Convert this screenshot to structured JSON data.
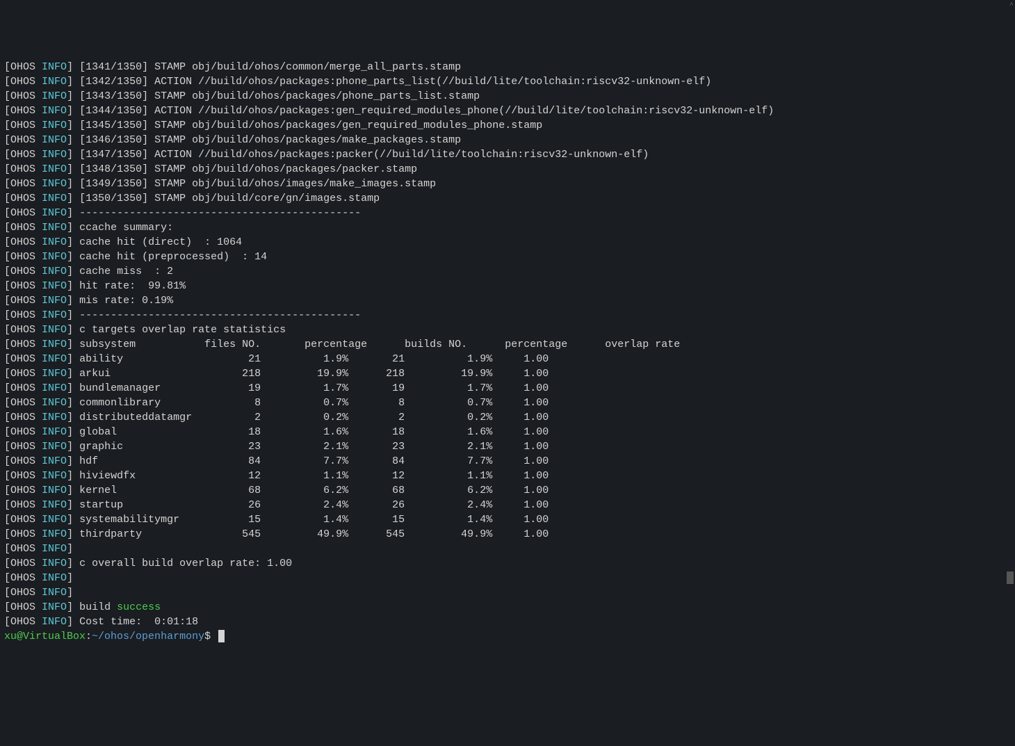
{
  "prefix": {
    "open": "[",
    "ohos": "OHOS",
    "space": " ",
    "info": "INFO",
    "close": "]"
  },
  "build_lines": [
    "[1341/1350] STAMP obj/build/ohos/common/merge_all_parts.stamp",
    "[1342/1350] ACTION //build/ohos/packages:phone_parts_list(//build/lite/toolchain:riscv32-unknown-elf)",
    "[1343/1350] STAMP obj/build/ohos/packages/phone_parts_list.stamp",
    "[1344/1350] ACTION //build/ohos/packages:gen_required_modules_phone(//build/lite/toolchain:riscv32-unknown-elf)",
    "[1345/1350] STAMP obj/build/ohos/packages/gen_required_modules_phone.stamp",
    "[1346/1350] STAMP obj/build/ohos/packages/make_packages.stamp",
    "[1347/1350] ACTION //build/ohos/packages:packer(//build/lite/toolchain:riscv32-unknown-elf)",
    "[1348/1350] STAMP obj/build/ohos/packages/packer.stamp",
    "[1349/1350] STAMP obj/build/ohos/images/make_images.stamp",
    "[1350/1350] STAMP obj/build/core/gn/images.stamp"
  ],
  "separator": "---------------------------------------------",
  "ccache": {
    "title": "ccache summary:",
    "hit_direct": "cache hit (direct)  : 1064",
    "hit_preprocessed": "cache hit (preprocessed)  : 14",
    "miss": "cache miss  : 2",
    "hit_rate": "hit rate:  99.81%",
    "mis_rate": "mis rate: 0.19%"
  },
  "stats": {
    "title": "c targets overlap rate statistics",
    "header": "subsystem           files NO.       percentage      builds NO.      percentage      overlap rate",
    "rows": [
      "ability                    21          1.9%       21          1.9%     1.00",
      "arkui                     218         19.9%      218         19.9%     1.00",
      "bundlemanager              19          1.7%       19          1.7%     1.00",
      "commonlibrary               8          0.7%        8          0.7%     1.00",
      "distributeddatamgr          2          0.2%        2          0.2%     1.00",
      "global                     18          1.6%       18          1.6%     1.00",
      "graphic                    23          2.1%       23          2.1%     1.00",
      "hdf                        84          7.7%       84          7.7%     1.00",
      "hiviewdfx                  12          1.1%       12          1.1%     1.00",
      "kernel                     68          6.2%       68          6.2%     1.00",
      "startup                    26          2.4%       26          2.4%     1.00",
      "systemabilitymgr           15          1.4%       15          1.4%     1.00",
      "thirdparty                545         49.9%      545         49.9%     1.00"
    ]
  },
  "overall": "c overall build overlap rate: 1.00",
  "build_label": " build ",
  "success": "success",
  "cost_time": "Cost time:  0:01:18",
  "prompt": {
    "user": "xu@VirtualBox",
    "colon": ":",
    "path": "~/ohos/openharmony",
    "dollar": "$ "
  }
}
